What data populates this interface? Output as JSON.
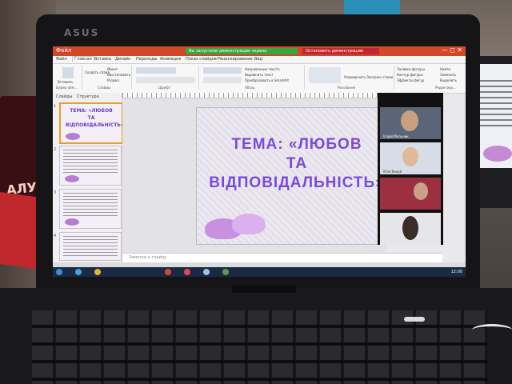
{
  "laptop": {
    "brand": "ASUS"
  },
  "app": {
    "quick_access": "Файл",
    "title_bar_green": "Вы запустили демонстрацию экрана",
    "stop_demo": "Остановить демонстрацию",
    "window_controls": "— ◻ ✕",
    "tabs": [
      "Файл",
      "Главная",
      "Вставка",
      "Дизайн",
      "Переходы",
      "Анимация",
      "Показ слайдов",
      "Рецензирование",
      "Вид"
    ],
    "active_tab": "Главная",
    "ribbon": {
      "groups": [
        "Буфер обм...",
        "Слайды",
        "Шрифт",
        "Абзац",
        "Рисование",
        "Редактиро..."
      ],
      "buttons": [
        "Вставить",
        "Создать слайд",
        "Макет",
        "Восстановить",
        "Раздел",
        "Направление текста",
        "Выровнять текст",
        "Преобразовать в SmartArt",
        "Упорядочить",
        "Экспресс-стили",
        "Заливка фигуры",
        "Контур фигуры",
        "Эффекты фигур",
        "Найти",
        "Заменить",
        "Выделить"
      ]
    },
    "panel": {
      "tabs": [
        "Слайды",
        "Структура"
      ]
    },
    "thumbnail_title": "ТЕМА: «ЛЮБОВ ТА ВІДПОВІДАЛЬНІСТЬ»",
    "thumb_numbers": [
      "1",
      "2",
      "3",
      "4"
    ],
    "notes_placeholder": "Заметки к слайду",
    "clock": "12:00"
  },
  "slide": {
    "title_lines": [
      "ТЕМА: «ЛЮБОВ",
      "ТА",
      "ВІДПОВІДАЛЬНІСТЬ»"
    ]
  },
  "conference": {
    "participants": [
      {
        "name": "Ігорій Мельник"
      },
      {
        "name": "Юля Вакуй"
      },
      {
        "name": ""
      },
      {
        "name": ""
      }
    ]
  },
  "background": {
    "poster_text": "АЛУРА"
  },
  "colors": {
    "title": "#7a4ad8",
    "ribbon_red": "#d24726",
    "share_green": "#3aa63c",
    "stop_red": "#c0282e"
  }
}
